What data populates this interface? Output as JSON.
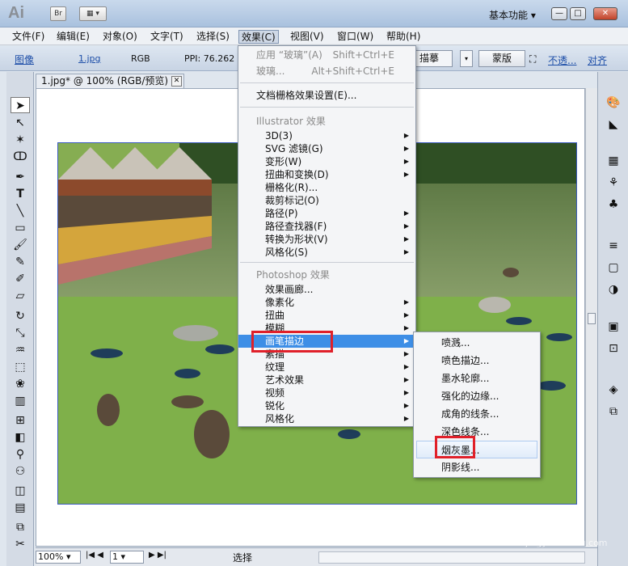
{
  "app": {
    "logo": "Ai",
    "br_label": "Br",
    "workspace": "基本功能"
  },
  "menubar": [
    "文件(F)",
    "编辑(E)",
    "对象(O)",
    "文字(T)",
    "选择(S)",
    "效果(C)",
    "视图(V)",
    "窗口(W)",
    "帮助(H)"
  ],
  "controlbar": {
    "type": "图像",
    "file": "1.jpg",
    "mode": "RGB",
    "ppi": "PPI: 76.262",
    "trace_right": "描摹",
    "mask_btn": "蒙版",
    "not_transparent": "不透...",
    "align": "对齐"
  },
  "tab": {
    "title": "1.jpg* @ 100% (RGB/预览)",
    "close": "✕"
  },
  "effects_menu": {
    "apply": {
      "label": "应用 “玻璃”(A)",
      "shortcut": "Shift+Ctrl+E"
    },
    "glass": {
      "label": "玻璃...",
      "shortcut": "Alt+Shift+Ctrl+E"
    },
    "doc_raster": "文档栅格效果设置(E)...",
    "illustrator_header": "Illustrator 效果",
    "illustrator_items": [
      "3D(3)",
      "SVG 滤镜(G)",
      "变形(W)",
      "扭曲和变换(D)",
      "栅格化(R)...",
      "裁剪标记(O)",
      "路径(P)",
      "路径查找器(F)",
      "转换为形状(V)",
      "风格化(S)"
    ],
    "photoshop_header": "Photoshop 效果",
    "photoshop_items": [
      "效果画廊...",
      "像素化",
      "扭曲",
      "模糊",
      "画笔描边",
      "素描",
      "纹理",
      "艺术效果",
      "视频",
      "锐化",
      "风格化"
    ]
  },
  "submenu": [
    "喷溅...",
    "喷色描边...",
    "墨水轮廓...",
    "强化的边缘...",
    "成角的线条...",
    "深色线条...",
    "烟灰墨...",
    "阴影线..."
  ],
  "statusbar": {
    "zoom": "100%",
    "page": "1",
    "tool": "选择"
  },
  "watermark": {
    "text": "Bai 经验",
    "url": "jingyan.baidu.com"
  }
}
